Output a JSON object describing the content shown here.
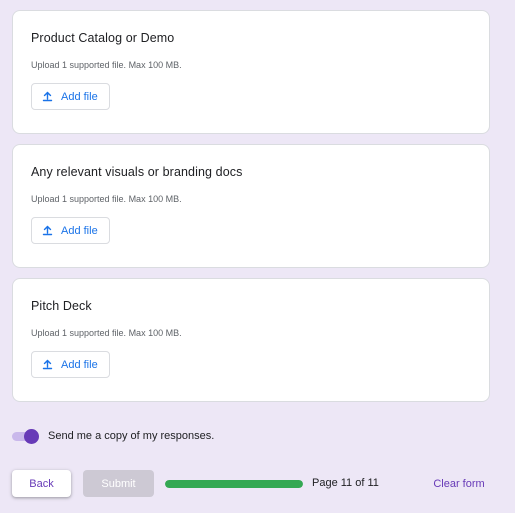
{
  "questions": [
    {
      "title": "Product Catalog or Demo",
      "help": "Upload 1 supported file. Max 100 MB.",
      "button_label": "Add file"
    },
    {
      "title": "Any relevant visuals or branding docs",
      "help": "Upload 1 supported file. Max 100 MB.",
      "button_label": "Add file"
    },
    {
      "title": "Pitch Deck",
      "help": "Upload 1 supported file. Max 100 MB.",
      "button_label": "Add file"
    }
  ],
  "copy_responses": {
    "label": "Send me a copy of my responses.",
    "enabled": true
  },
  "footer": {
    "back_label": "Back",
    "submit_label": "Submit",
    "progress_fraction": 1.0,
    "page_label": "Page 11 of 11",
    "clear_label": "Clear form"
  },
  "icons": {
    "upload": "upload-icon"
  },
  "colors": {
    "background": "#ede7f6",
    "accent": "#673ab7",
    "link_blue": "#1a73e8",
    "progress": "#34a853",
    "submit_disabled": "#cdc9d4"
  }
}
